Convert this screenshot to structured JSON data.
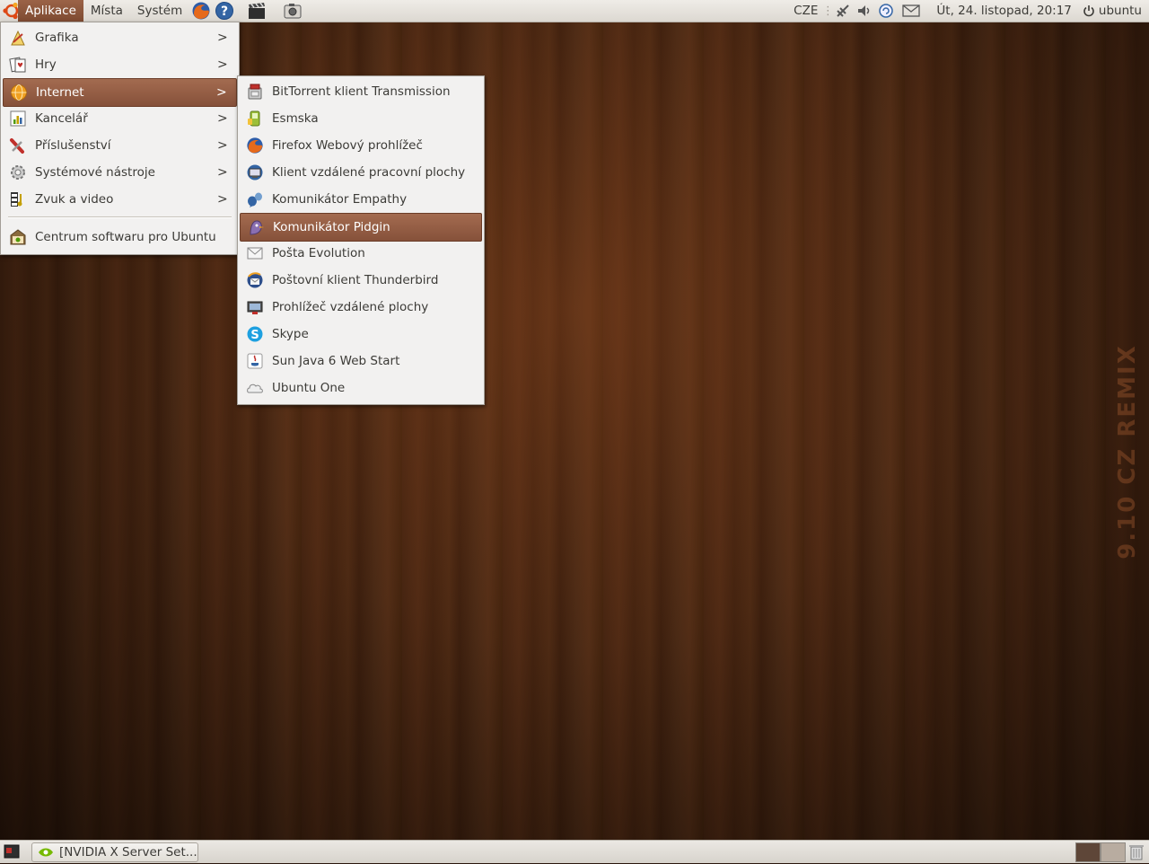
{
  "top_panel": {
    "menus": [
      "Aplikace",
      "Místa",
      "Systém"
    ],
    "keyboard_layout": "CZE",
    "clock": "Út, 24. listopad, 20:17",
    "user": "ubuntu"
  },
  "main_menu": {
    "items": [
      {
        "label": "Grafika",
        "icon": "graphics-icon",
        "submenu": true
      },
      {
        "label": "Hry",
        "icon": "games-icon",
        "submenu": true
      },
      {
        "label": "Internet",
        "icon": "internet-icon",
        "submenu": true
      },
      {
        "label": "Kancelář",
        "icon": "office-icon",
        "submenu": true
      },
      {
        "label": "Příslušenství",
        "icon": "accessories-icon",
        "submenu": true
      },
      {
        "label": "Systémové nástroje",
        "icon": "system-tools-icon",
        "submenu": true
      },
      {
        "label": "Zvuk a video",
        "icon": "sound-video-icon",
        "submenu": true
      }
    ],
    "footer_item": {
      "label": "Centrum softwaru pro Ubuntu",
      "icon": "software-center-icon"
    }
  },
  "internet_submenu": {
    "items": [
      {
        "label": "BitTorrent klient Transmission",
        "icon": "transmission-icon"
      },
      {
        "label": "Esmska",
        "icon": "esmska-icon"
      },
      {
        "label": "Firefox Webový prohlížeč",
        "icon": "firefox-icon"
      },
      {
        "label": "Klient vzdálené pracovní plochy",
        "icon": "remote-desktop-client-icon"
      },
      {
        "label": "Komunikátor Empathy",
        "icon": "empathy-icon"
      },
      {
        "label": "Komunikátor Pidgin",
        "icon": "pidgin-icon"
      },
      {
        "label": "Pošta Evolution",
        "icon": "evolution-icon"
      },
      {
        "label": "Poštovní klient Thunderbird",
        "icon": "thunderbird-icon"
      },
      {
        "label": "Prohlížeč vzdálené plochy",
        "icon": "remote-desktop-viewer-icon"
      },
      {
        "label": "Skype",
        "icon": "skype-icon"
      },
      {
        "label": "Sun Java 6 Web Start",
        "icon": "java-icon"
      },
      {
        "label": "Ubuntu One",
        "icon": "ubuntu-one-icon"
      }
    ],
    "highlighted": "Komunikátor Pidgin"
  },
  "desktop": {
    "watermark": "9.10 CZ REMIX"
  },
  "bottom_panel": {
    "task_label": "[NVIDIA X Server Set..."
  },
  "colors": {
    "accent": "#8b543b",
    "panel": "#e6e2dc",
    "menu_bg": "#f2f1f0"
  }
}
